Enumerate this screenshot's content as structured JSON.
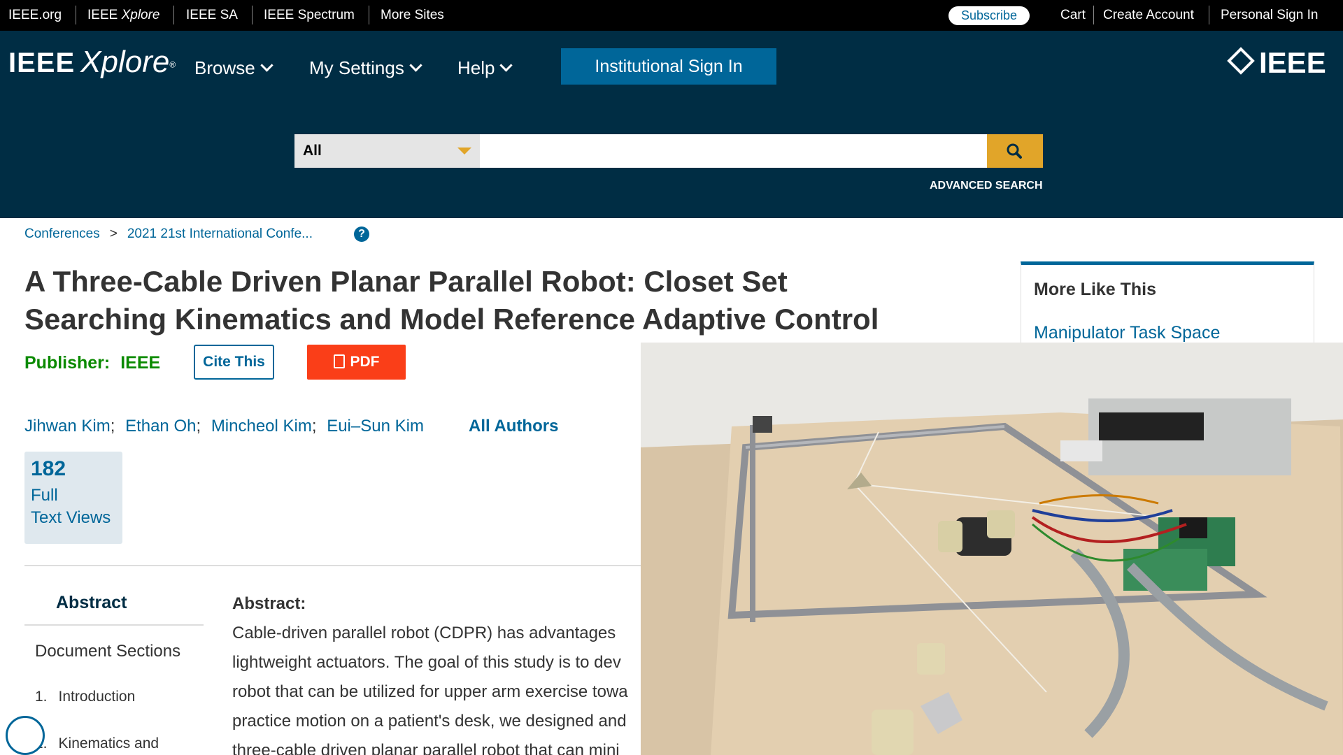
{
  "meta_bar": {
    "links": [
      "IEEE.org",
      "IEEE Xplore",
      "IEEE SA",
      "IEEE Spectrum",
      "More Sites"
    ],
    "subscribe": "Subscribe",
    "right_links": [
      "Cart",
      "Create Account",
      "Personal Sign In"
    ]
  },
  "header": {
    "logo_ieee": "IEEE",
    "logo_xplore": "Xplore",
    "nav": [
      "Browse",
      "My Settings",
      "Help"
    ],
    "institutional_sign_in": "Institutional Sign In",
    "brand": "IEEE"
  },
  "search": {
    "scope": "All",
    "placeholder": "",
    "advanced": "ADVANCED SEARCH"
  },
  "breadcrumb": [
    "Conferences",
    "2021 21st International Confe..."
  ],
  "document": {
    "title_line1": "A Three-Cable Driven Planar Parallel Robot: Closet Set",
    "title_line2": "Searching Kinematics and Model Reference Adaptive Control",
    "publisher_label": "Publisher:",
    "publisher": "IEEE",
    "cite_this": "Cite This",
    "pdf": "PDF",
    "authors": [
      "Jihwan Kim",
      "Ethan Oh",
      "Mincheol Kim",
      "Eui–Sun Kim"
    ],
    "all_authors": "All Authors",
    "metric_value": "182",
    "metric_label_1": "Full",
    "metric_label_2": "Text Views"
  },
  "side_nav": {
    "abstract": "Abstract",
    "document_sections": "Document Sections",
    "sections": [
      {
        "num": "1.",
        "label": "Introduction"
      },
      {
        "num": "2.",
        "label": "Kinematics and"
      }
    ]
  },
  "abstract": {
    "heading": "Abstract:",
    "lines": [
      "Cable-driven parallel robot (CDPR) has advantages",
      "lightweight actuators. The goal of this study is to dev",
      "robot that can be utilized for upper arm exercise towa",
      "practice motion on a patient's desk, we designed and",
      "three-cable driven planar parallel robot that can mini"
    ]
  },
  "more_like_this": {
    "title": "More Like This",
    "first_link": "Manipulator Task Space"
  },
  "colors": {
    "header_bg": "#002d44",
    "accent_blue": "#006699",
    "pdf_red": "#fa3e18",
    "search_gold": "#e1a529",
    "publisher_green": "#0b8a00"
  }
}
